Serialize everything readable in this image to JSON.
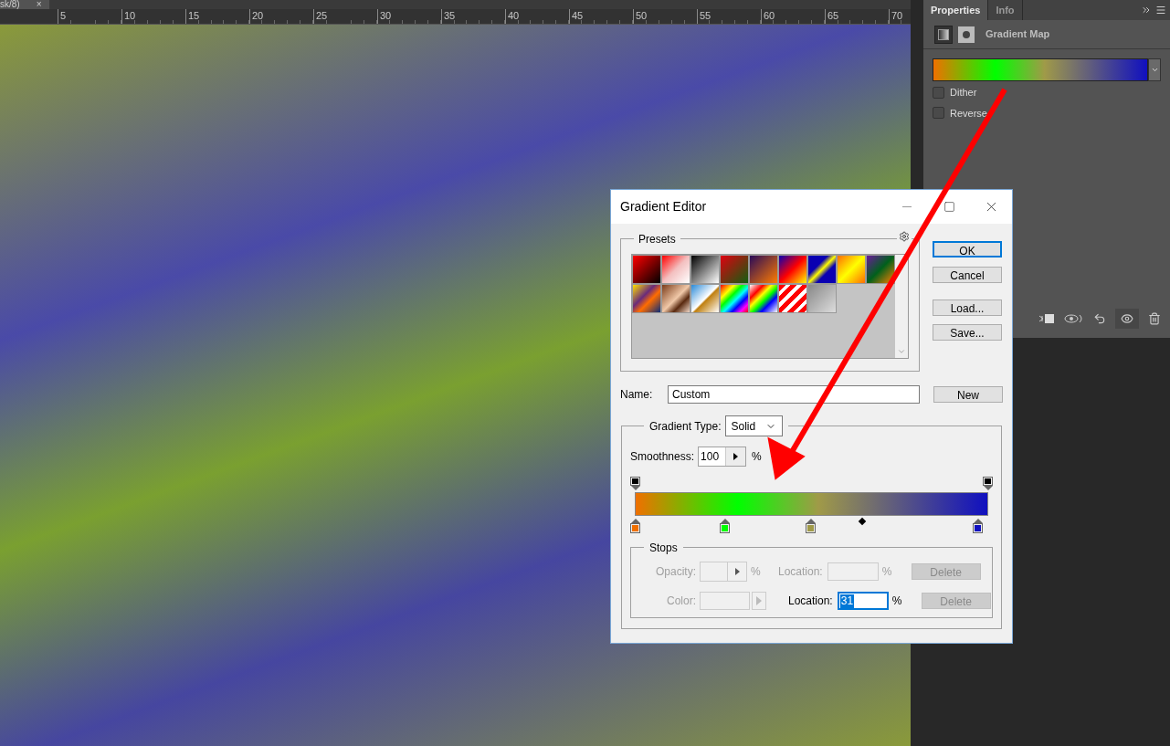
{
  "document_tab": {
    "title": "sk/8)",
    "close": "×"
  },
  "ruler": {
    "labels": [
      "5",
      "10",
      "15",
      "20",
      "25",
      "30",
      "35",
      "40",
      "45",
      "50",
      "55",
      "60",
      "65",
      "70"
    ]
  },
  "properties_panel": {
    "tabs": [
      {
        "label": "Properties",
        "selected": true
      },
      {
        "label": "Info",
        "selected": false
      }
    ],
    "adjustment_title": "Gradient Map",
    "options": [
      {
        "label": "Dither",
        "checked": false
      },
      {
        "label": "Reverse",
        "checked": false
      }
    ]
  },
  "gradient": {
    "color_stops": [
      {
        "color": "#f07000"
      },
      {
        "color": "#00ff00"
      },
      {
        "color": "#a09a48"
      },
      {
        "color": "#1010c0"
      }
    ]
  },
  "dialog": {
    "title": "Gradient Editor",
    "presets_label": "Presets",
    "buttons": [
      {
        "label": "OK",
        "default": true
      },
      {
        "label": "Cancel",
        "default": false
      },
      {
        "label": "Load...",
        "default": false
      },
      {
        "label": "Save...",
        "default": false
      }
    ],
    "name_label": "Name:",
    "name_value": "Custom",
    "new_button": "New",
    "gradient_type_label": "Gradient Type:",
    "gradient_type": "Solid",
    "smoothness_label": "Smoothness:",
    "smoothness": "100",
    "smoothness_unit": "%",
    "stops_label": "Stops",
    "opacity_row": {
      "label": "Opacity:",
      "unit": "%",
      "location_label": "Location:",
      "location_unit": "%",
      "delete": "Delete",
      "disabled": true
    },
    "color_row": {
      "label": "Color:",
      "disabled": true,
      "location_label": "Location:",
      "location_value": "31",
      "location_unit": "%",
      "delete": "Delete",
      "delete_disabled": true
    }
  }
}
